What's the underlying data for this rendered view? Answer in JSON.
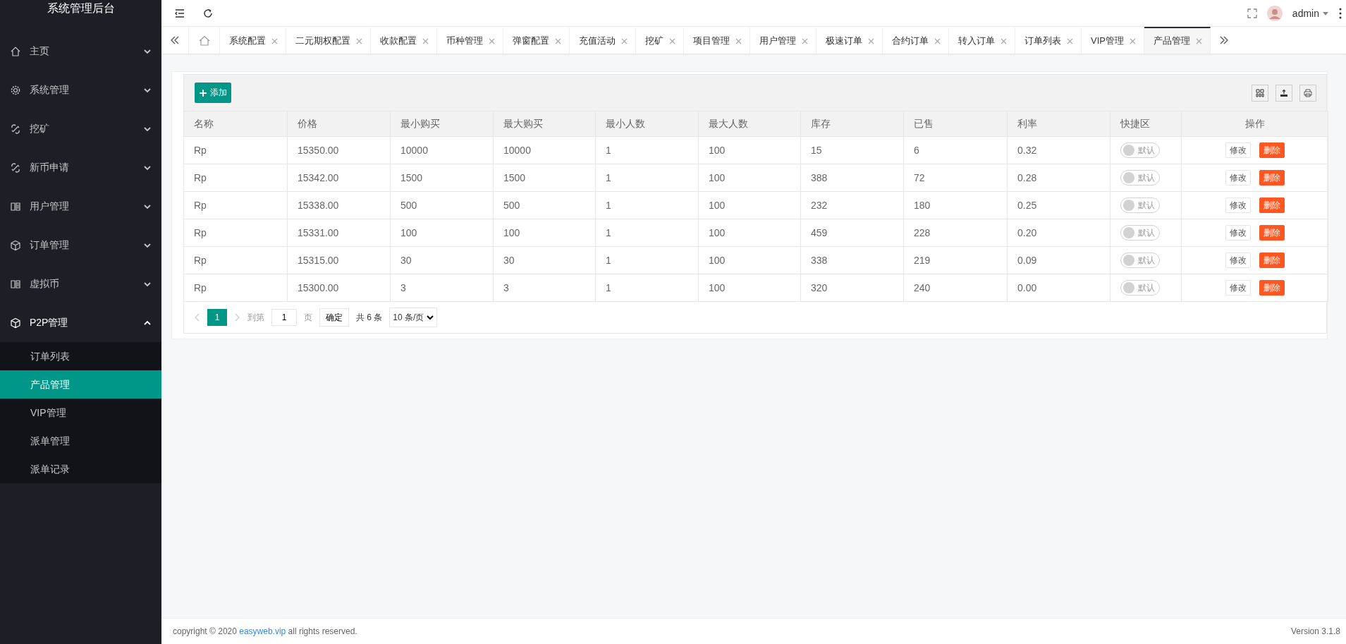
{
  "sidebar": {
    "title": "系统管理后台",
    "items": [
      {
        "label": "主页",
        "expanded": false
      },
      {
        "label": "系统管理",
        "expanded": false
      },
      {
        "label": "挖矿",
        "expanded": false
      },
      {
        "label": "新币申请",
        "expanded": false
      },
      {
        "label": "用户管理",
        "expanded": false
      },
      {
        "label": "订单管理",
        "expanded": false
      },
      {
        "label": "虚拟币",
        "expanded": false
      },
      {
        "label": "P2P管理",
        "expanded": true,
        "children": [
          {
            "label": "订单列表",
            "selected": false
          },
          {
            "label": "产品管理",
            "selected": true
          },
          {
            "label": "VIP管理",
            "selected": false
          },
          {
            "label": "派单管理",
            "selected": false
          },
          {
            "label": "派单记录",
            "selected": false
          }
        ]
      }
    ]
  },
  "header": {
    "user": "admin"
  },
  "tabs": [
    {
      "label": "系统配置",
      "selected": false
    },
    {
      "label": "二元期权配置",
      "selected": false
    },
    {
      "label": "收款配置",
      "selected": false
    },
    {
      "label": "币种管理",
      "selected": false
    },
    {
      "label": "弹窗配置",
      "selected": false
    },
    {
      "label": "充值活动",
      "selected": false
    },
    {
      "label": "挖矿",
      "selected": false
    },
    {
      "label": "项目管理",
      "selected": false
    },
    {
      "label": "用户管理",
      "selected": false
    },
    {
      "label": "极速订单",
      "selected": false
    },
    {
      "label": "合约订单",
      "selected": false
    },
    {
      "label": "转入订单",
      "selected": false
    },
    {
      "label": "订单列表",
      "selected": false
    },
    {
      "label": "VIP管理",
      "selected": false
    },
    {
      "label": "产品管理",
      "selected": true
    }
  ],
  "toolbar": {
    "add_button": "添加"
  },
  "table": {
    "columns": [
      "名称",
      "价格",
      "最小购买",
      "最大购买",
      "最小人数",
      "最大人数",
      "库存",
      "已售",
      "利率",
      "快捷区",
      "操作"
    ],
    "rows": [
      {
        "cells": [
          "Rp",
          "15350.00",
          "10000",
          "10000",
          "1",
          "100",
          "15",
          "6",
          "0.32"
        ],
        "quick": {
          "on": false,
          "label": "默认"
        },
        "actions": [
          {
            "label": "修改",
            "kind": "edit"
          },
          {
            "label": "删除",
            "kind": "delete"
          }
        ]
      },
      {
        "cells": [
          "Rp",
          "15342.00",
          "1500",
          "1500",
          "1",
          "100",
          "388",
          "72",
          "0.28"
        ],
        "quick": {
          "on": false,
          "label": "默认"
        },
        "actions": [
          {
            "label": "修改",
            "kind": "edit"
          },
          {
            "label": "删除",
            "kind": "delete"
          }
        ]
      },
      {
        "cells": [
          "Rp",
          "15338.00",
          "500",
          "500",
          "1",
          "100",
          "232",
          "180",
          "0.25"
        ],
        "quick": {
          "on": false,
          "label": "默认"
        },
        "actions": [
          {
            "label": "修改",
            "kind": "edit"
          },
          {
            "label": "删除",
            "kind": "delete"
          }
        ]
      },
      {
        "cells": [
          "Rp",
          "15331.00",
          "100",
          "100",
          "1",
          "100",
          "459",
          "228",
          "0.20"
        ],
        "quick": {
          "on": false,
          "label": "默认"
        },
        "actions": [
          {
            "label": "修改",
            "kind": "edit"
          },
          {
            "label": "删除",
            "kind": "delete"
          }
        ]
      },
      {
        "cells": [
          "Rp",
          "15315.00",
          "30",
          "30",
          "1",
          "100",
          "338",
          "219",
          "0.09"
        ],
        "quick": {
          "on": false,
          "label": "默认"
        },
        "actions": [
          {
            "label": "修改",
            "kind": "edit"
          },
          {
            "label": "删除",
            "kind": "delete"
          }
        ]
      },
      {
        "cells": [
          "Rp",
          "15300.00",
          "3",
          "3",
          "1",
          "100",
          "320",
          "240",
          "0.00"
        ],
        "quick": {
          "on": false,
          "label": "默认"
        },
        "actions": [
          {
            "label": "修改",
            "kind": "edit"
          },
          {
            "label": "删除",
            "kind": "delete"
          }
        ]
      }
    ]
  },
  "pagination": {
    "pages": [
      {
        "label": "1",
        "selected": true
      }
    ],
    "goto_label": "到第",
    "page_input": "1",
    "page_unit": "页",
    "confirm": "确定",
    "total": "共 6 条",
    "page_size": "10 条/页"
  },
  "footer": {
    "copyright": "copyright © 2020",
    "link": "easyweb.vip",
    "rights": "all rights reserved.",
    "version": "Version 3.1.8"
  }
}
